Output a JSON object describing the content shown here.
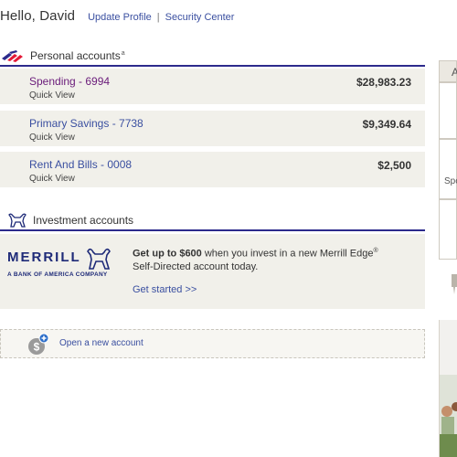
{
  "header": {
    "greeting": "Hello, David",
    "links": [
      {
        "label": "Update Profile"
      },
      {
        "label": "Security Center"
      }
    ],
    "separator": "|"
  },
  "personal": {
    "title": "Personal accounts",
    "superscript": "a",
    "accounts": [
      {
        "name": "Spending - 6994",
        "quick_view": "Quick View",
        "balance": "$28,983.23"
      },
      {
        "name": "Primary Savings - 7738",
        "quick_view": "Quick View",
        "balance": "$9,349.64"
      },
      {
        "name": "Rent And Bills - 0008",
        "quick_view": "Quick View",
        "balance": "$2,500"
      }
    ]
  },
  "investment": {
    "title": "Investment accounts",
    "merrill_wordmark": "MERRILL",
    "merrill_tagline": "A BANK OF AMERICA COMPANY",
    "promo_bold": "Get up to $600",
    "promo_rest": " when you invest in a new Merrill Edge",
    "promo_reg": "®",
    "promo_line2": "Self-Directed account today.",
    "cta": "Get started >>"
  },
  "open_account": {
    "label": "Open a new account"
  },
  "right_rail": {
    "top_letter": "A",
    "mid_text": "Spe"
  },
  "colors": {
    "accent_navy": "#2c2a8c",
    "link_blue": "#3a4fa0",
    "visited_purple": "#6a1b7a",
    "panel_bg": "#f1f0ea",
    "boa_red": "#e31837"
  }
}
